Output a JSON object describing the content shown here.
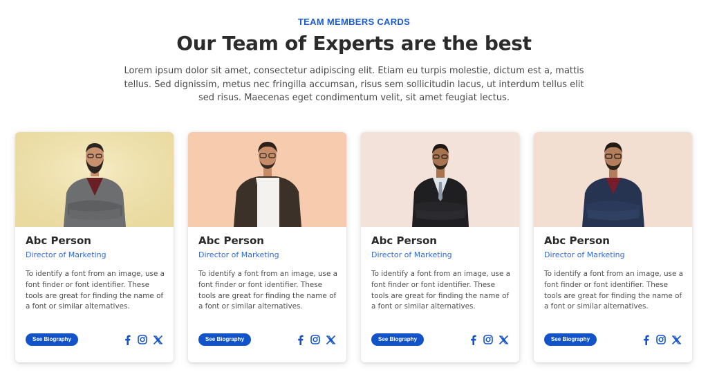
{
  "header": {
    "eyebrow": "TEAM MEMBERS CARDS",
    "title": "Our Team of Experts are the best",
    "lead": "Lorem ipsum dolor sit amet, consectetur adipiscing elit. Etiam eu turpis molestie, dictum est a, mattis tellus. Sed dignissim, metus nec fringilla accumsan, risus sem sollicitudin lacus, ut interdum tellus elit sed risus. Maecenas eget condimentum velit, sit amet feugiat lectus."
  },
  "colors": {
    "accent": "#1a5bd6",
    "button": "#1353c9",
    "role_text": "#2f6ad9",
    "social_icons": "#1353c9"
  },
  "cards": [
    {
      "name": "Abc Person",
      "role": "Director of Marketing",
      "description": "To identify a font from an image, use a font finder or font identifier. These tools are great for finding the name of a font or similar alternatives.",
      "button_label": "See Biography",
      "photo_bg": "#efe3b0",
      "socials": [
        "facebook-icon",
        "instagram-icon",
        "x-icon"
      ]
    },
    {
      "name": "Abc Person",
      "role": "Director of Marketing",
      "description": "To identify a font from an image, use a font finder or font identifier. These tools are great for finding the name of a font or similar alternatives.",
      "button_label": "See Biography",
      "photo_bg": "#f7cdb2",
      "socials": [
        "facebook-icon",
        "instagram-icon",
        "x-icon"
      ]
    },
    {
      "name": "Abc Person",
      "role": "Director of Marketing",
      "description": "To identify a font from an image, use a font finder or font identifier. These tools are great for finding the name of a font or similar alternatives.",
      "button_label": "See Biography",
      "photo_bg": "#f3e3dc",
      "socials": [
        "facebook-icon",
        "instagram-icon",
        "x-icon"
      ]
    },
    {
      "name": "Abc Person",
      "role": "Director of Marketing",
      "description": "To identify a font from an image, use a font finder or font identifier. These tools are great for finding the name of a font or similar alternatives.",
      "button_label": "See Biography",
      "photo_bg": "#f3e0d4",
      "socials": [
        "facebook-icon",
        "instagram-icon",
        "x-icon"
      ]
    }
  ]
}
